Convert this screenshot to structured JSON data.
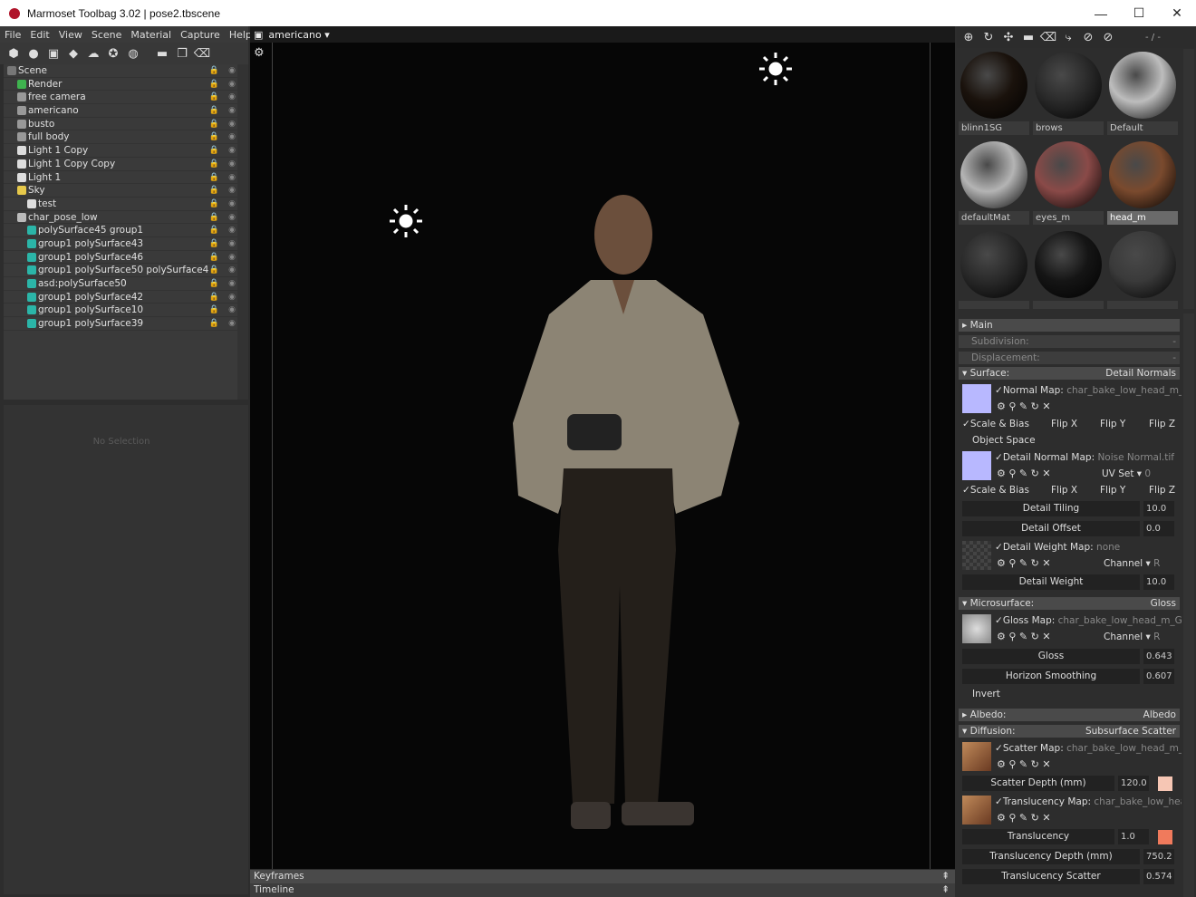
{
  "window": {
    "title": "Marmoset Toolbag 3.02  |  pose2.tbscene",
    "controls": [
      "—",
      "☐",
      "✕"
    ]
  },
  "menu": [
    "File",
    "Edit",
    "View",
    "Scene",
    "Material",
    "Capture",
    "Help"
  ],
  "scene_tree": [
    {
      "label": "Scene",
      "depth": 0,
      "icon": "scene-icon"
    },
    {
      "label": "Render",
      "depth": 1,
      "icon": "render-icon"
    },
    {
      "label": "free camera",
      "depth": 1,
      "icon": "camera-icon"
    },
    {
      "label": "americano",
      "depth": 1,
      "icon": "camera-icon"
    },
    {
      "label": "busto",
      "depth": 1,
      "icon": "camera-icon"
    },
    {
      "label": "full body",
      "depth": 1,
      "icon": "camera-icon"
    },
    {
      "label": "Light 1 Copy",
      "depth": 1,
      "icon": "light-icon"
    },
    {
      "label": "Light 1 Copy Copy",
      "depth": 1,
      "icon": "light-icon"
    },
    {
      "label": "Light 1",
      "depth": 1,
      "icon": "light-icon"
    },
    {
      "label": "Sky",
      "depth": 1,
      "icon": "sky-icon"
    },
    {
      "label": "test",
      "depth": 2,
      "icon": "light-icon"
    },
    {
      "label": "char_pose_low",
      "depth": 1,
      "icon": "mesh-icon"
    },
    {
      "label": "polySurface45 group1",
      "depth": 2,
      "icon": "cube-icon"
    },
    {
      "label": "group1 polySurface43",
      "depth": 2,
      "icon": "cube-icon"
    },
    {
      "label": "group1 polySurface46",
      "depth": 2,
      "icon": "cube-icon"
    },
    {
      "label": "group1 polySurface50 polySurface4",
      "depth": 2,
      "icon": "cube-icon"
    },
    {
      "label": "asd:polySurface50",
      "depth": 2,
      "icon": "cube-icon"
    },
    {
      "label": "group1 polySurface42",
      "depth": 2,
      "icon": "cube-icon"
    },
    {
      "label": "group1 polySurface10",
      "depth": 2,
      "icon": "cube-icon"
    },
    {
      "label": "group1 polySurface39",
      "depth": 2,
      "icon": "cube-icon"
    }
  ],
  "properties": {
    "empty": "No Selection"
  },
  "viewport": {
    "camera": "americano ▾"
  },
  "timeline": {
    "keyframes": "Keyframes",
    "timeline": "Timeline"
  },
  "material_bar": {
    "counter": "- / -"
  },
  "materials": [
    {
      "name": "blinn1SG",
      "color": "#1a120c"
    },
    {
      "name": "brows",
      "color": "#2a2a2a"
    },
    {
      "name": "Default",
      "color": "#bdbdbd"
    },
    {
      "name": "defaultMat",
      "color": "#b4b4b4"
    },
    {
      "name": "eyes_m",
      "color": "#8a4a48"
    },
    {
      "name": "head_m",
      "color": "#7a4a2e"
    },
    {
      "name": "",
      "color": "#2a2a2a"
    },
    {
      "name": "",
      "color": "#151515"
    },
    {
      "name": "",
      "color": "#3a3a3a"
    }
  ],
  "inspector": {
    "main": "Main",
    "subdivision": "Subdivision:",
    "subdivision_v": "-",
    "displacement": "Displacement:",
    "displacement_v": "-",
    "surface": "Surface:",
    "surface_v": "Detail Normals",
    "normal_map": "Normal Map:",
    "normal_map_v": "char_bake_low_head_m_N",
    "scale_bias": "Scale & Bias",
    "flip_x": "Flip X",
    "flip_y": "Flip Y",
    "flip_z": "Flip Z",
    "object_space": "Object Space",
    "detail_normal_map": "Detail Normal Map:",
    "detail_normal_map_v": "Noise Normal.tif",
    "uv_set": "UV Set",
    "uv_set_v": "0",
    "detail_tiling": "Detail Tiling",
    "detail_tiling_v": "10.0",
    "detail_offset": "Detail Offset",
    "detail_offset_v": "0.0",
    "detail_weight_map": "Detail Weight Map:",
    "detail_weight_map_v": "none",
    "channel": "Channel",
    "channel_v": "R",
    "detail_weight": "Detail Weight",
    "detail_weight_v": "10.0",
    "microsurface": "Microsurface:",
    "microsurface_v": "Gloss",
    "gloss_map": "Gloss Map:",
    "gloss_map_v": "char_bake_low_head_m_Glos",
    "gloss": "Gloss",
    "gloss_v": "0.643",
    "horizon": "Horizon Smoothing",
    "horizon_v": "0.607",
    "invert": "Invert",
    "albedo": "Albedo:",
    "albedo_v": "Albedo",
    "diffusion": "Diffusion:",
    "diffusion_v": "Subsurface Scatter",
    "scatter_map": "Scatter Map:",
    "scatter_map_v": "char_bake_low_head_m_SS",
    "scatter_depth": "Scatter Depth (mm)",
    "scatter_depth_v": "120.0",
    "translucency_map": "Translucency Map:",
    "translucency_map_v": "char_bake_low_head",
    "translucency": "Translucency",
    "translucency_v": "1.0",
    "translucency_depth": "Translucency Depth (mm)",
    "translucency_depth_v": "750.2",
    "translucency_scatter": "Translucency Scatter",
    "translucency_scatter_v": "0.574",
    "colors": {
      "normal_thumb": "#b8b8ff",
      "scatter_swatch": "#f6c6b4",
      "translucency_swatch": "#f07a5c"
    }
  }
}
